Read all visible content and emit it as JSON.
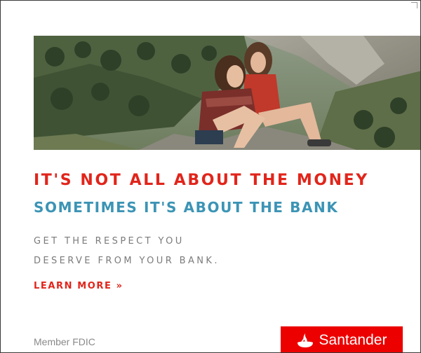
{
  "ad": {
    "headline_primary": "IT'S NOT ALL ABOUT THE MONEY",
    "headline_secondary": "SOMETIMES IT'S ABOUT THE BANK",
    "subtext_line1": "GET THE RESPECT YOU",
    "subtext_line2": "DESERVE FROM YOUR BANK.",
    "cta_label": "LEARN MORE »",
    "disclaimer": "Member FDIC",
    "brand_name": "Santander",
    "icons": {
      "photo": "two-women-mountain-photo",
      "brand_logo": "santander-flame-icon"
    },
    "colors": {
      "headline_red": "#e1251b",
      "headline_blue": "#3c94b5",
      "brand_red": "#ec0000",
      "subtext_gray": "#7b7b7b"
    }
  }
}
